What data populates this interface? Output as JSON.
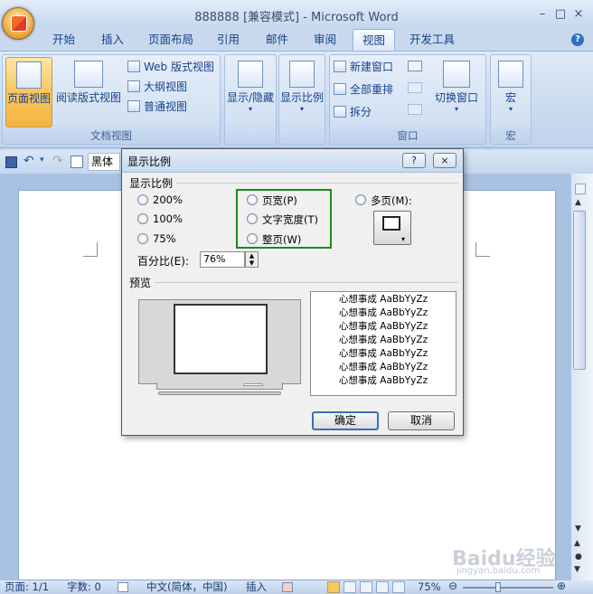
{
  "window": {
    "title": "888888 [兼容模式] - Microsoft Word",
    "minimize": "–",
    "maximize": "□",
    "close": "×",
    "help": "?"
  },
  "tabs": [
    "开始",
    "插入",
    "页面布局",
    "引用",
    "邮件",
    "审阅",
    "视图",
    "开发工具"
  ],
  "active_tab": "视图",
  "ribbon": {
    "doc_views": {
      "group_label": "文档视图",
      "page_view": "页面视图",
      "reading_view": "阅读版式视图",
      "web_view": "Web 版式视图",
      "outline_view": "大纲视图",
      "draft_view": "普通视图"
    },
    "show_hide": "显示/隐藏",
    "zoom": "显示比例",
    "window": {
      "group_label": "窗口",
      "new_window": "新建窗口",
      "arrange_all": "全部重排",
      "split": "拆分",
      "switch_windows": "切换窗口"
    },
    "macros": {
      "group_label": "宏",
      "macros": "宏"
    }
  },
  "qat": {
    "font": "黑体"
  },
  "dialog": {
    "title": "显示比例",
    "help_btn": "?",
    "close_btn": "×",
    "section_zoom": "显示比例",
    "radio_200": "200%",
    "radio_100": "100%",
    "radio_75": "75%",
    "radio_page_width": "页宽(P)",
    "radio_text_width": "文字宽度(T)",
    "radio_whole_page": "整页(W)",
    "radio_many_pages": "多页(M):",
    "percent_label": "百分比(E):",
    "percent_value": "76%",
    "section_preview": "预览",
    "preview_lines": [
      "心想事成 AaBbYyZz",
      "心想事成 AaBbYyZz",
      "心想事成 AaBbYyZz",
      "心想事成 AaBbYyZz",
      "心想事成 AaBbYyZz",
      "心想事成 AaBbYyZz",
      "心想事成 AaBbYyZz"
    ],
    "ok": "确定",
    "cancel": "取消"
  },
  "status": {
    "page": "页面: 1/1",
    "words": "字数: 0",
    "language": "中文(简体，中国)",
    "insert": "插入",
    "zoom": "75%"
  },
  "watermark": {
    "brand": "Baidu经验",
    "url": "jingyan.baidu.com"
  },
  "colors": {
    "ribbon_text": "#15428b",
    "highlight_box": "#1b8a1b",
    "active_button": "#f8c65f"
  }
}
